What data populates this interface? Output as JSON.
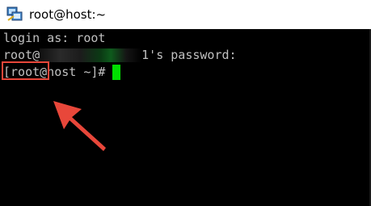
{
  "window": {
    "title": "root@host:~",
    "icon": "putty-terminal-icon"
  },
  "terminal": {
    "line1": "login as: root",
    "line2_user": "root@",
    "line2_suffix": "1's password:",
    "prompt": "[root@host ~]# ",
    "cursor_color": "#00e000",
    "text_color": "#c0c0c0",
    "background": "#000000"
  },
  "annotation": {
    "color": "#e8473a",
    "arrow_icon": "red-arrow-icon"
  }
}
